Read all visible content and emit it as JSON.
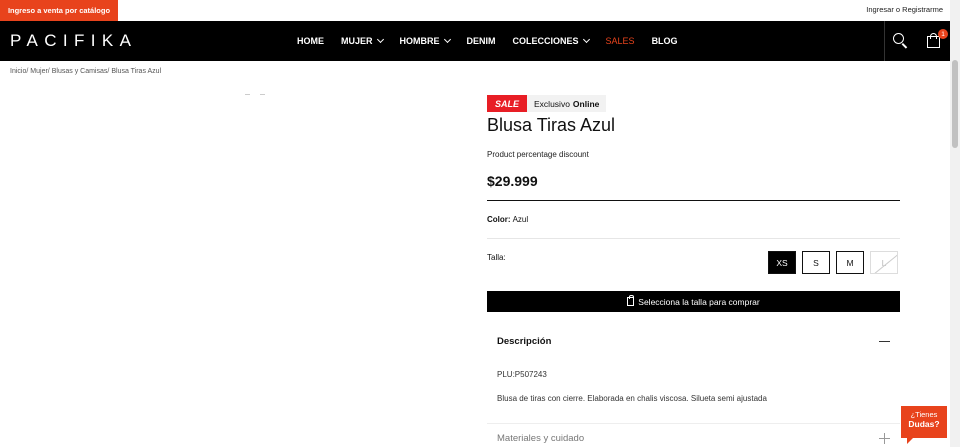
{
  "topbar": {
    "catalog_label": "Ingreso a venta por catálogo",
    "login_label": "Ingresar o Registrarme"
  },
  "brand": {
    "logo": "PACIFIKA"
  },
  "menu": {
    "items": [
      {
        "label": "HOME",
        "dropdown": false
      },
      {
        "label": "MUJER",
        "dropdown": true
      },
      {
        "label": "HOMBRE",
        "dropdown": true
      },
      {
        "label": "DENIM",
        "dropdown": false
      },
      {
        "label": "COLECCIONES",
        "dropdown": true
      },
      {
        "label": "SALES",
        "dropdown": false
      },
      {
        "label": "BLOG",
        "dropdown": false
      }
    ]
  },
  "cart": {
    "count": "1"
  },
  "breadcrumb": [
    "Inicio/",
    "Mujer/",
    "Blusas y Camisas/",
    "Blusa Tiras Azul"
  ],
  "product": {
    "sale_badge": "SALE",
    "exclusive_prefix": "Exclusivo",
    "exclusive_bold": "Online",
    "title": "Blusa Tiras Azul",
    "discount_text": "Product percentage discount",
    "price": "$29.999",
    "color_label": "Color:",
    "color_value": "Azul",
    "size_label": "Talla:",
    "sizes": [
      "XS",
      "S",
      "M",
      "L"
    ],
    "buy_label": "Selecciona la talla para comprar"
  },
  "description": {
    "title": "Descripción",
    "plu": "PLU:P507243",
    "body": "Blusa de tiras con cierre. Elaborada en chalis viscosa. Silueta semi ajustada"
  },
  "materials": {
    "title": "Materiales y cuidado"
  },
  "help": {
    "line1": "¿Tienes",
    "line2": "Dudas?"
  },
  "colors": {
    "accent": "#e8431c",
    "sale": "#e81e25",
    "nav_bg": "#000000"
  }
}
